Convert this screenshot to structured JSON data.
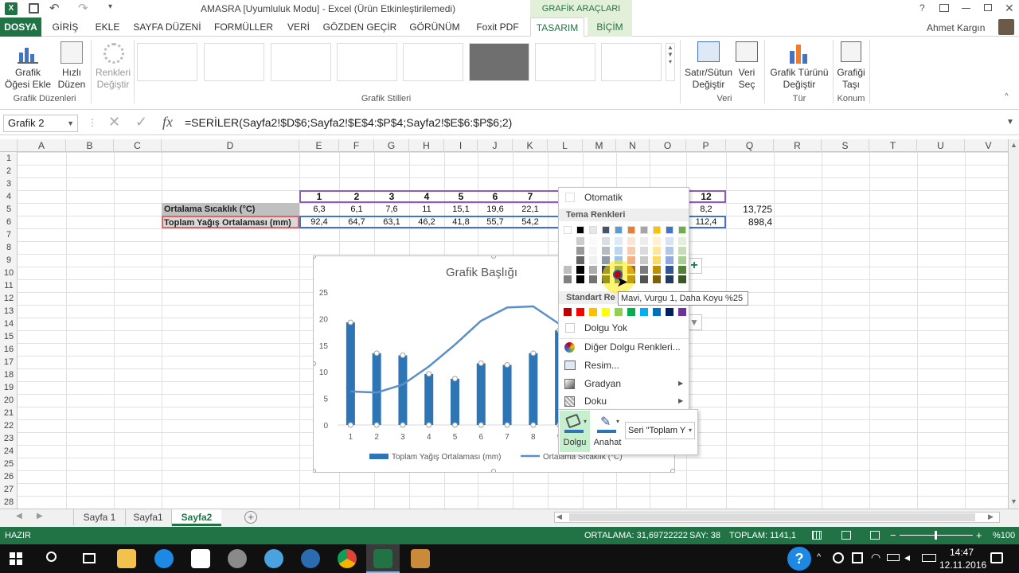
{
  "title_bar": {
    "title": "AMASRA  [Uyumluluk Modu] - Excel (Ürün Etkinleştirilemedi)",
    "context_tab": "GRAFİK ARAÇLARI",
    "help": "?"
  },
  "ribbon_tabs": [
    "DOSYA",
    "GİRİŞ",
    "EKLE",
    "SAYFA DÜZENİ",
    "FORMÜLLER",
    "VERİ",
    "GÖZDEN GEÇİR",
    "GÖRÜNÜM",
    "Foxit PDF",
    "TASARIM",
    "BİÇİM"
  ],
  "user": "Ahmet Kargın",
  "ribbon": {
    "add_element": "Grafik Öğesi Ekle",
    "quick_layout": "Hızlı Düzen",
    "change_colors": "Renkleri Değiştir",
    "group_layouts": "Grafik Düzenleri",
    "group_styles": "Grafik Stilleri",
    "switch_row_col": "Satır/Sütun Değiştir",
    "select_data": "Veri Seç",
    "group_data": "Veri",
    "change_type": "Grafik Türünü Değiştir",
    "group_type": "Tür",
    "move_chart": "Grafiği Taşı",
    "group_location": "Konum"
  },
  "formula_bar": {
    "name_box": "Grafik 2",
    "fx": "fx",
    "formula": "=SERİLER(Sayfa2!$D$6;Sayfa2!$E$4:$P$4;Sayfa2!$E$6:$P$6;2)"
  },
  "columns": [
    "A",
    "B",
    "C",
    "D",
    "E",
    "F",
    "G",
    "H",
    "I",
    "J",
    "K",
    "L",
    "M",
    "N",
    "O",
    "P",
    "Q",
    "R",
    "S",
    "T",
    "U",
    "V"
  ],
  "rows": [
    "1",
    "2",
    "3",
    "4",
    "5",
    "6",
    "7",
    "8",
    "9",
    "10",
    "11",
    "12",
    "13",
    "14",
    "15",
    "16",
    "17",
    "18",
    "19",
    "20",
    "21",
    "22",
    "23",
    "24",
    "25",
    "26",
    "27",
    "28"
  ],
  "table": {
    "header_months": [
      "1",
      "2",
      "3",
      "4",
      "5",
      "6",
      "7"
    ],
    "header_last": "12",
    "row5_label": "Ortalama Sıcaklık (°C)",
    "row5_values": [
      "6,3",
      "6,1",
      "7,6",
      "11",
      "15,1",
      "19,6",
      "22,1"
    ],
    "row5_last": "8,2",
    "row5_total": "13,725",
    "row6_label": "Toplam Yağış Ortalaması (mm)",
    "row6_values": [
      "92,4",
      "64,7",
      "63,1",
      "46,2",
      "41,8",
      "55,7",
      "54,2"
    ],
    "row6_last": "112,4",
    "row6_total": "898,4"
  },
  "chart_data": {
    "type": "bar",
    "title": "Grafik Başlığı",
    "categories": [
      "1",
      "2",
      "3",
      "4",
      "5",
      "6",
      "7",
      "8",
      "9"
    ],
    "yticks": [
      "0",
      "5",
      "10",
      "15",
      "20",
      "25"
    ],
    "ylim": [
      0,
      25
    ],
    "series": [
      {
        "name": "Toplam Yağış Ortalaması (mm)",
        "type": "bar",
        "values": [
          19.3,
          13.5,
          13.1,
          9.6,
          8.7,
          11.6,
          11.3,
          13.5,
          17.8
        ]
      },
      {
        "name": "Ortalama Sıcaklık (°C)",
        "type": "line",
        "values": [
          6.3,
          6.1,
          7.6,
          11,
          15.1,
          19.6,
          22.1,
          22.3,
          19
        ]
      }
    ],
    "colors": {
      "bar": "#2e75b6",
      "line": "#5b8fc9"
    }
  },
  "color_picker": {
    "automatic": "Otomatik",
    "theme_colors": "Tema Renkleri",
    "standard_colors": "Standart Re",
    "no_fill": "Dolgu Yok",
    "more_colors": "Diğer Dolgu Renkleri...",
    "picture": "Resim...",
    "gradient": "Gradyan",
    "texture": "Doku",
    "tooltip": "Mavi, Vurgu 1, Daha Koyu %25",
    "theme_top": [
      "#ffffff",
      "#000000",
      "#e7e6e6",
      "#44546a",
      "#5b9bd5",
      "#ed7d31",
      "#a5a5a5",
      "#ffc000",
      "#4472c4",
      "#70ad47"
    ],
    "standard": [
      "#c00000",
      "#ff0000",
      "#ffc000",
      "#ffff00",
      "#92d050",
      "#00b050",
      "#00b0f0",
      "#0070c0",
      "#002060",
      "#7030a0"
    ]
  },
  "mini_toolbar": {
    "fill": "Dolgu",
    "outline": "Anahat",
    "series": "Seri \"Toplam Y"
  },
  "sheet_tabs": [
    "Sayfa 1",
    "Sayfa1",
    "Sayfa2"
  ],
  "status_bar": {
    "ready": "HAZIR",
    "average": "ORTALAMA: 31,69722222",
    "count": "SAY: 38",
    "sum": "TOPLAM: 1141,1",
    "zoom": "%100"
  },
  "taskbar": {
    "time": "14:47",
    "date": "12.11.2016"
  }
}
